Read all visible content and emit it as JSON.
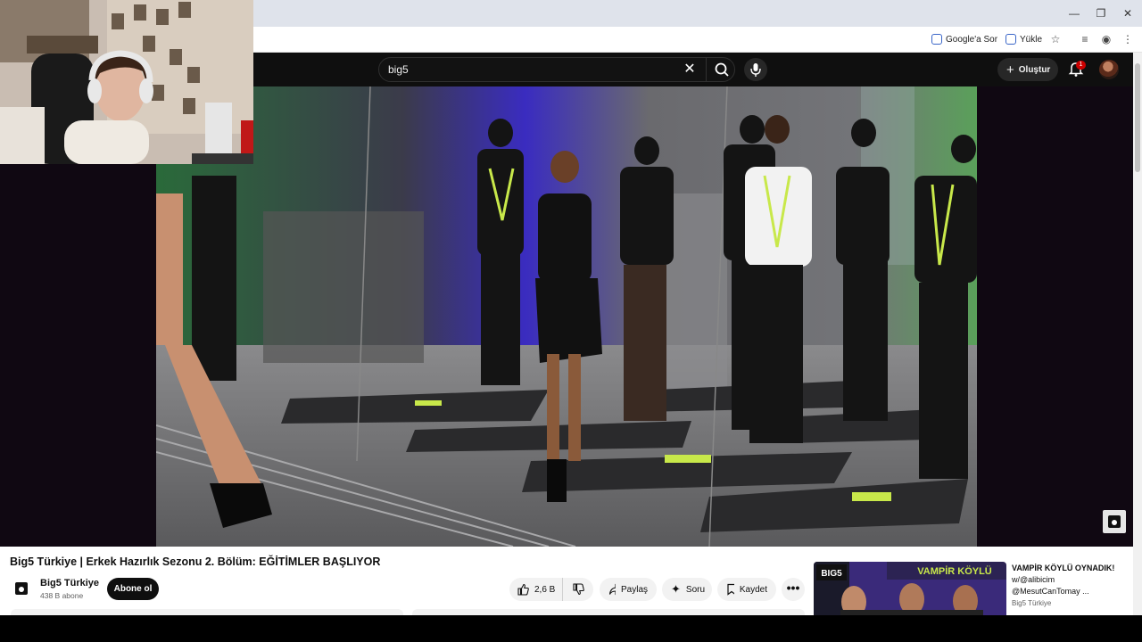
{
  "browser": {
    "window_controls": {
      "minimize": "—",
      "restore": "❐",
      "close": "✕"
    },
    "toolbar": {
      "ask_google_label": "Google'a Sor",
      "upload_label": "Yükle"
    }
  },
  "youtube": {
    "search": {
      "query": "big5"
    },
    "header": {
      "create_label": "Oluştur",
      "notification_count": "1"
    },
    "video": {
      "title": "Big5 Türkiye | Erkek Hazırlık Sezonu 2. Bölüm: EĞİTİMLER BAŞLIYOR",
      "channel_name": "Big5 Türkiye",
      "subscribers": "438 B abone",
      "subscribe_label": "Abone ol",
      "likes": "2,6 B",
      "share_label": "Paylaş",
      "ask_label": "Soru",
      "save_label": "Kaydet",
      "more_label": "•••"
    },
    "recommendation": {
      "thumb_text": "VAMPİR KÖYLÜ",
      "thumb_logo": "BIG5",
      "title_lines": [
        "VAMPİR KÖYLÜ OYNADIK!",
        "w/@alibicim",
        "@MesutCanTomay ..."
      ],
      "channel": "Big5 Türkiye"
    }
  },
  "colors": {
    "youtube_dark": "#0f0f0f",
    "accent_green": "#c8e84a",
    "notification_red": "#cc0000"
  }
}
